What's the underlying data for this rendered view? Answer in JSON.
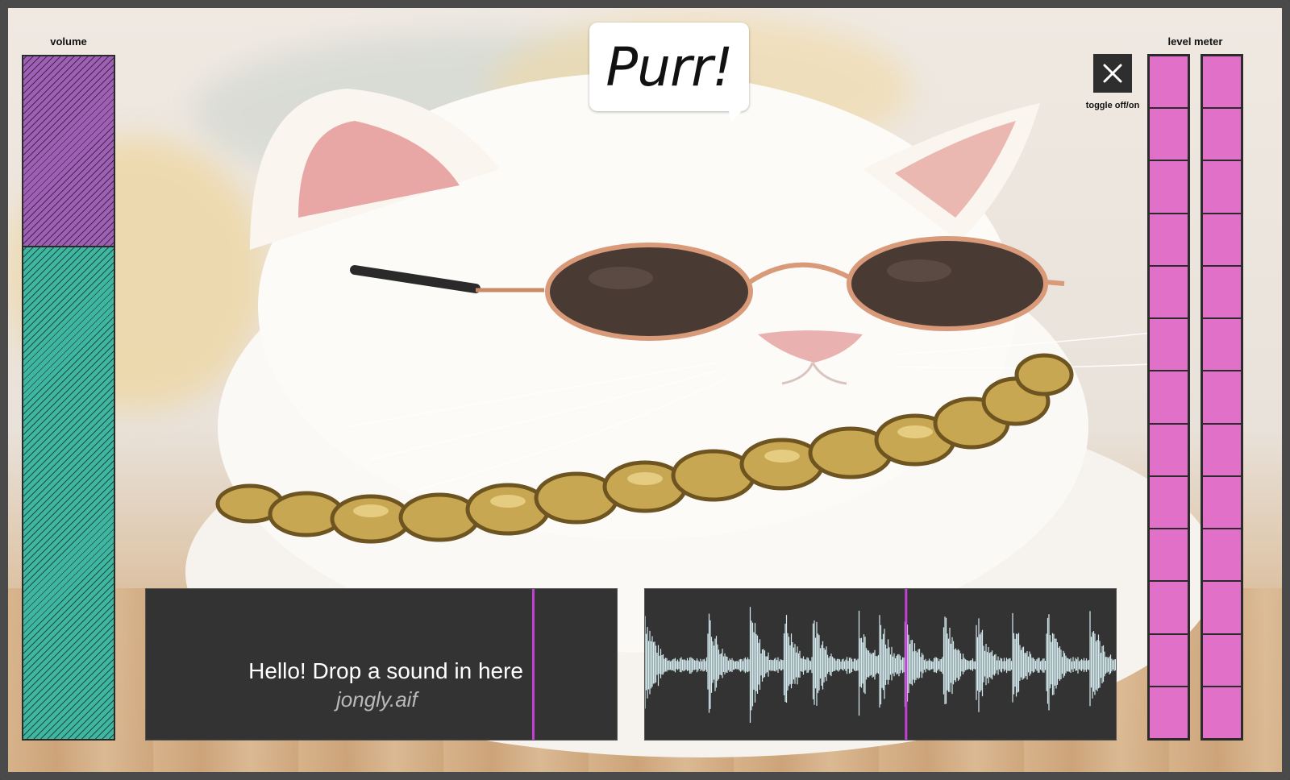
{
  "volume": {
    "label": "volume",
    "level": 0.72,
    "color_fill": "#3fb6a0",
    "color_empty": "#9f5fb5"
  },
  "speech_bubble": {
    "text": "Purr!"
  },
  "toggle": {
    "label": "toggle off/on",
    "icon": "close-icon"
  },
  "level_meter": {
    "label": "level meter",
    "segments": 13,
    "channels": 2,
    "color": "#e070c8"
  },
  "drop_zone": {
    "title": "Hello! Drop a sound in here",
    "filename": "jongly.aif",
    "playhead": 0.82,
    "playhead_color": "#c33fd6"
  },
  "waveform": {
    "playhead": 0.55,
    "color": "#d4ebf0",
    "background": "#333333"
  },
  "background": {
    "image": "white-cat-sunglasses-gold-chain"
  }
}
